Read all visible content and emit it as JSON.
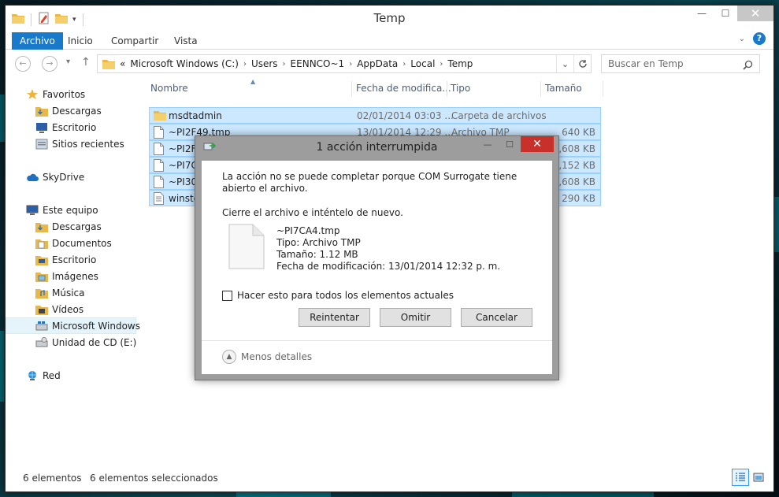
{
  "window": {
    "title": "Temp",
    "controls": [
      "minimize",
      "maximize",
      "close"
    ]
  },
  "ribbon": {
    "tabs": [
      {
        "label": "Archivo",
        "active": true
      },
      {
        "label": "Inicio"
      },
      {
        "label": "Compartir"
      },
      {
        "label": "Vista"
      }
    ]
  },
  "address": {
    "overflow": "«",
    "crumbs": [
      "Microsoft Windows (C:)",
      "Users",
      "EENNCO~1",
      "AppData",
      "Local",
      "Temp"
    ]
  },
  "search": {
    "placeholder": "Buscar en Temp"
  },
  "navpane": {
    "items": [
      {
        "label": "Favoritos",
        "icon": "star-icon",
        "level": 0
      },
      {
        "label": "Descargas",
        "icon": "downloads-folder-icon",
        "level": 1
      },
      {
        "label": "Escritorio",
        "icon": "desktop-icon",
        "level": 1
      },
      {
        "label": "Sitios recientes",
        "icon": "recent-places-icon",
        "level": 1
      },
      {
        "label": "SkyDrive",
        "icon": "skydrive-cloud-icon",
        "level": 0
      },
      {
        "label": "Este equipo",
        "icon": "computer-icon",
        "level": 0
      },
      {
        "label": "Descargas",
        "icon": "downloads-folder-icon",
        "level": 1
      },
      {
        "label": "Documentos",
        "icon": "documents-folder-icon",
        "level": 1
      },
      {
        "label": "Escritorio",
        "icon": "desktop-folder-icon",
        "level": 1
      },
      {
        "label": "Imágenes",
        "icon": "pictures-folder-icon",
        "level": 1
      },
      {
        "label": "Música",
        "icon": "music-folder-icon",
        "level": 1
      },
      {
        "label": "Vídeos",
        "icon": "videos-folder-icon",
        "level": 1
      },
      {
        "label": "Microsoft Windows",
        "icon": "windows-drive-icon",
        "level": 1,
        "selected": true
      },
      {
        "label": "Unidad de CD (E:)",
        "icon": "cd-drive-icon",
        "level": 1
      },
      {
        "label": "Red",
        "icon": "network-icon",
        "level": 0
      }
    ]
  },
  "filelist": {
    "columns": [
      "Nombre",
      "Fecha de modifica...",
      "Tipo",
      "Tamaño"
    ],
    "rows": [
      {
        "name": "msdtadmin",
        "date": "02/01/2014 03:03 ...",
        "type": "Carpeta de archivos",
        "size": "",
        "icon": "folder-icon"
      },
      {
        "name": "~PI2F49.tmp",
        "date": "13/01/2014 12:29 ...",
        "type": "Archivo TMP",
        "size": "640 KB",
        "icon": "file-icon"
      },
      {
        "name": "~PI2F7",
        "date": "",
        "type": "",
        "size": "4,608 KB",
        "icon": "file-icon"
      },
      {
        "name": "~PI7CA",
        "date": "",
        "type": "",
        "size": "1,152 KB",
        "icon": "file-icon"
      },
      {
        "name": "~PI30C",
        "date": "",
        "type": "",
        "size": "4,608 KB",
        "icon": "file-icon"
      },
      {
        "name": "winsto",
        "date": "",
        "type": "",
        "size": "290 KB",
        "icon": "text-file-icon"
      }
    ]
  },
  "statusbar": {
    "count": "6 elementos",
    "selected": "6 elementos seleccionados"
  },
  "dialog": {
    "title": "1 acción interrumpida",
    "message": "La acción no se puede completar porque COM Surrogate tiene abierto el archivo.",
    "instruction": "Cierre el archivo e inténtelo de nuevo.",
    "file": {
      "name": "~PI7CA4.tmp",
      "type": "Tipo: Archivo TMP",
      "size": "Tamaño: 1.12 MB",
      "modified": "Fecha de modificación: 13/01/2014 12:32 p. m."
    },
    "checkbox_label": "Hacer esto para todos los elementos actuales",
    "buttons": {
      "retry": "Reintentar",
      "skip": "Omitir",
      "cancel": "Cancelar"
    },
    "details_toggle": "Menos detalles"
  },
  "colors": {
    "accent": "#1979ca",
    "selection": "#cce8ff",
    "close_red": "#c7302b"
  }
}
